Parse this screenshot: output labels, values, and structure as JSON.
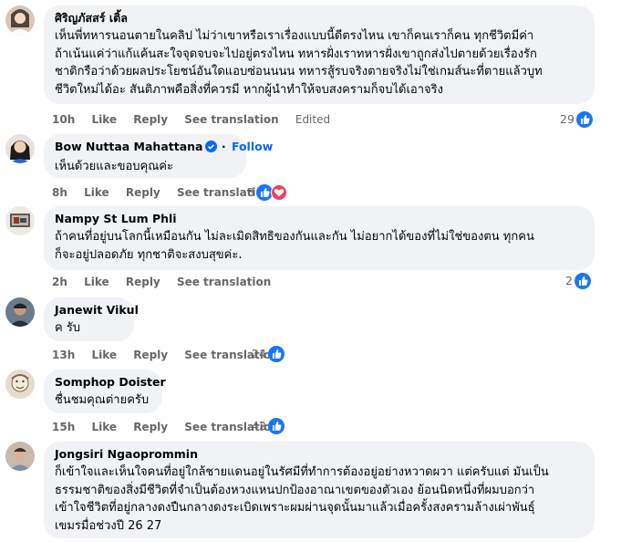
{
  "colors": {
    "accent": "#0866ff",
    "like": "#1877f2",
    "love": "#f33e58",
    "bubble": "#f0f2f5",
    "meta": "#65676b"
  },
  "actions": {
    "like": "Like",
    "reply": "Reply",
    "see_translation": "See translation"
  },
  "comments": [
    {
      "author": "ศิริญภัสสร์ เติ้ล",
      "lines": [
        "เห็นพี่ทหารนอนตายในคลิป ไม่ว่าเขาหรือเราเรื่องแบบนี้ดีตรงไหน เขาก็คนเราก็คน ทุกชีวิตมีค่า",
        "ถ้าเน้นแค่ว่าแก้แค้นสะใจจุดจบจะไปอยู่ตรงไหน ทหารฝั่งเราทหารฝั่งเขาถูกส่งไปตายด้วยเรื่องรัก",
        "ชาติกรือว่าด้วยผลประโยชน์อันใดแอบซ่อนนนน ทหารสู้รบจริงตายจริงไม่ใช่เกมส์นะที่ตายแล้วบูท",
        "ชีวิตใหม่ได้อะ สันติภาพคือสิ่งที่ควรมี หากผู้นำทำให้จบสงครามก็จบได้เอาจริง"
      ],
      "time": "10h",
      "edited": "Edited",
      "reactions": "29",
      "reaction_icons": [
        "like-icon"
      ]
    },
    {
      "author": "Bow Nuttaa Mahattana",
      "follow": "Follow",
      "lines": [
        "เห็นด้วยและขอบคุณค่ะ"
      ],
      "time": "8h",
      "reactions": "8",
      "reaction_icons": [
        "like-icon",
        "love-icon"
      ]
    },
    {
      "author": "Nampy St Lum Phli",
      "lines": [
        "ถ้าคนที่อยู่บนโลกนี้เหมือนกัน ไม่ละเมิดสิทธิของกันและกัน ไม่อยากได้ของที่ไม่ใช่ของตน ทุกคน",
        "ก็จะอยู่ปลอดภัย ทุกชาติจะสงบสุขค่ะ."
      ],
      "time": "2h",
      "reactions": "2",
      "reaction_icons": [
        "like-icon"
      ]
    },
    {
      "author": "Janewit Vikul",
      "lines": [
        "ค รับ"
      ],
      "time": "13h",
      "reactions": "24",
      "reaction_icons": [
        "like-icon"
      ]
    },
    {
      "author": "Somphop Doister",
      "lines": [
        "ชื่นชมคุณต่ายครับ"
      ],
      "time": "15h",
      "reactions": "42",
      "reaction_icons": [
        "like-icon"
      ]
    },
    {
      "author": "Jongsiri Ngaoprommin",
      "lines": [
        "ก็เข้าใจและเห็นใจคนที่อยู่ใกล้ชายแดนอยู่ในรัศมีที่ทำการต้องอยู่อย่างหวาดผวา แต่ครับแต่ มันเป็น",
        "ธรรมชาติของสิ่งมีชีวิตที่จำเป็นต้องหวงแหนปกป้องอาณาเขตของตัวเอง ย้อนนิดหนึ่งที่ผมบอกว่า",
        "เข้าใจชีวิตที่อยู่กลางดงปืนกลางดงระเบิดเพราะผมผ่านจุดนั้นมาแล้วเมื่อครั้งสงครามล้างเผ่าพันธุ์",
        "เขมรมื่อช่วงปี 26 27"
      ]
    }
  ]
}
